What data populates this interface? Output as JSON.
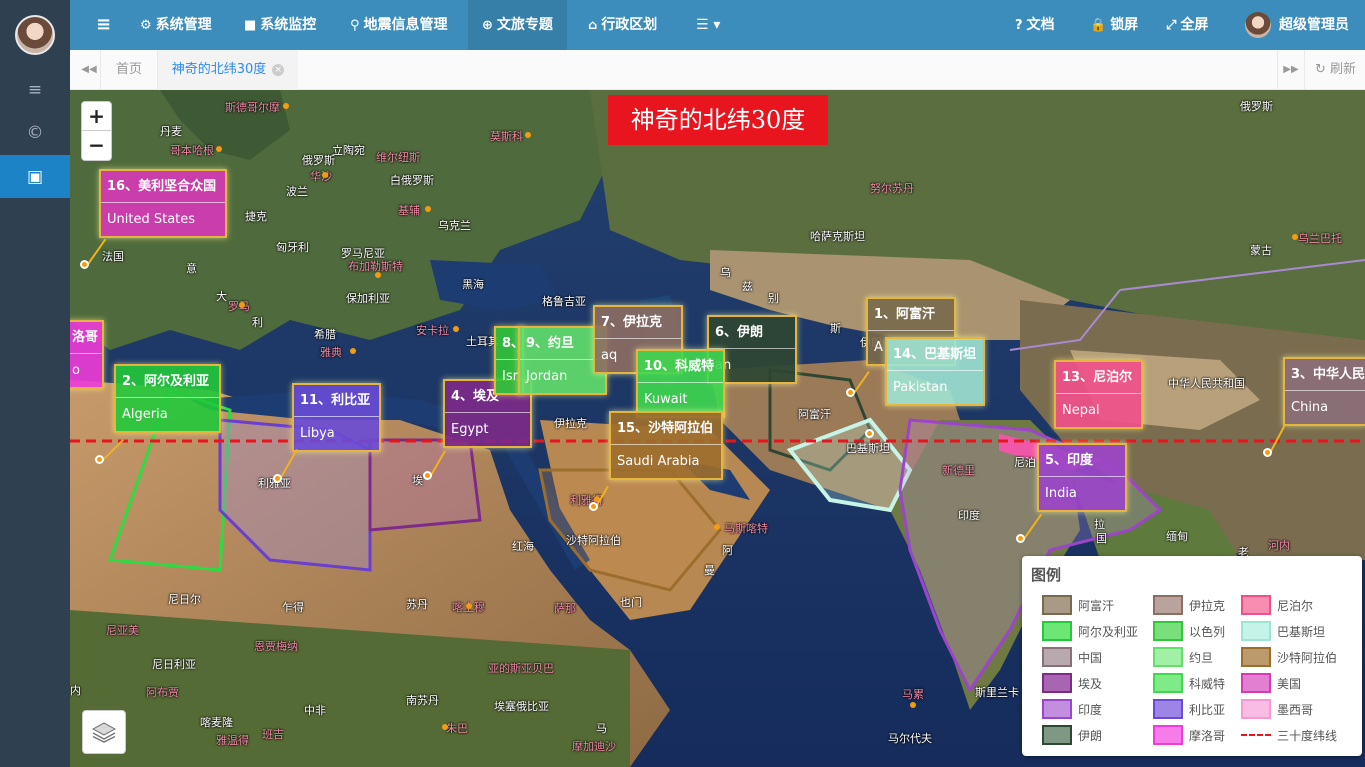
{
  "sidebar": {
    "items": [
      {
        "icon": "menu-icon",
        "glyph": "≡"
      },
      {
        "icon": "copyright-icon",
        "glyph": "©"
      },
      {
        "icon": "image-icon",
        "glyph": "▣"
      }
    ]
  },
  "topnav": {
    "menu_glyph": "≡",
    "items": [
      {
        "label": "系统管理",
        "icon": "gear-icon",
        "glyph": "⚙"
      },
      {
        "label": "系统监控",
        "icon": "video-camera-icon",
        "glyph": "■"
      },
      {
        "label": "地震信息管理",
        "icon": "map-marker-icon",
        "glyph": "⚲"
      },
      {
        "label": "文旅专题",
        "icon": "globe-icon",
        "glyph": "⊕"
      },
      {
        "label": "行政区划",
        "icon": "bank-icon",
        "glyph": "⌂"
      }
    ],
    "more_glyph": "☰ ▾",
    "right": {
      "docs": "文档",
      "docs_glyph": "?",
      "lock": "锁屏",
      "lock_glyph": "🔒",
      "fullscreen": "全屏",
      "fullscreen_glyph": "⤢",
      "user": "超级管理员"
    }
  },
  "tabs": {
    "prev_glyph": "◀◀",
    "next_glyph": "▶▶",
    "home": "首页",
    "current": "神奇的北纬30度",
    "close_glyph": "×",
    "refresh": "刷新",
    "refresh_glyph": "↻"
  },
  "map": {
    "title": "神奇的北纬30度",
    "zoom_in": "+",
    "zoom_out": "−",
    "countries": [
      {
        "cn": "16、美利坚合众国",
        "en": "United States",
        "color": "#d63ab6"
      },
      {
        "cn": "洛哥",
        "en": "o",
        "color": "#f03cd8"
      },
      {
        "cn": "2、阿尔及利亚",
        "en": "Algeria",
        "color": "#22c93a"
      },
      {
        "cn": "11、利比亚",
        "en": "Libya",
        "color": "#6a4bd6"
      },
      {
        "cn": "4、埃及",
        "en": "Egypt",
        "color": "#7d2a88"
      },
      {
        "cn": "8、",
        "en": "Isr",
        "color": "#32c63a"
      },
      {
        "cn": "9、约旦",
        "en": "Jordan",
        "color": "#62e06a"
      },
      {
        "cn": "7、伊拉克",
        "en": "aq",
        "color": "#8d6e63"
      },
      {
        "cn": "6、伊朗",
        "en": "an",
        "color": "#2e4733"
      },
      {
        "cn": "10、科威特",
        "en": "Kuwait",
        "color": "#3fd84f"
      },
      {
        "cn": "15、沙特阿拉伯",
        "en": "Saudi Arabia",
        "color": "#9c6e2c"
      },
      {
        "cn": "1、阿富汗",
        "en": "A",
        "color": "#7a6a4d"
      },
      {
        "cn": "14、巴基斯坦",
        "en": "Pakistan",
        "color": "#9ee4d2"
      },
      {
        "cn": "13、尼泊尔",
        "en": "Nepal",
        "color": "#f0508a"
      },
      {
        "cn": "5、印度",
        "en": "India",
        "color": "#9b45c8"
      },
      {
        "cn": "3、中华人民",
        "en": "China",
        "color": "#8a6f78"
      }
    ],
    "labels": [
      {
        "t": "斯德哥尔摩",
        "c": "p"
      },
      {
        "t": "丹麦",
        "c": "w"
      },
      {
        "t": "哥本哈根",
        "c": "p"
      },
      {
        "t": "立陶宛",
        "c": "w"
      },
      {
        "t": "维尔纽斯",
        "c": "p"
      },
      {
        "t": "俄罗斯",
        "c": "w"
      },
      {
        "t": "明斯克",
        "c": "p"
      },
      {
        "t": "华沙",
        "c": "p"
      },
      {
        "t": "白俄罗斯",
        "c": "w"
      },
      {
        "t": "波兰",
        "c": "w"
      },
      {
        "t": "基辅",
        "c": "p"
      },
      {
        "t": "捷克",
        "c": "w"
      },
      {
        "t": "乌克兰",
        "c": "w"
      },
      {
        "t": "匈牙利",
        "c": "w"
      },
      {
        "t": "罗马尼亚",
        "c": "w"
      },
      {
        "t": "布加勒斯特",
        "c": "p"
      },
      {
        "t": "法国",
        "c": "w"
      },
      {
        "t": "意",
        "c": "w"
      },
      {
        "t": "黑海",
        "c": "w"
      },
      {
        "t": "大",
        "c": "w"
      },
      {
        "t": "罗马",
        "c": "p"
      },
      {
        "t": "保加利亚",
        "c": "w"
      },
      {
        "t": "格鲁吉亚",
        "c": "w"
      },
      {
        "t": "安卡拉",
        "c": "p"
      },
      {
        "t": "土耳其",
        "c": "w"
      },
      {
        "t": "利",
        "c": "w"
      },
      {
        "t": "希腊",
        "c": "w"
      },
      {
        "t": "雅典",
        "c": "p"
      },
      {
        "t": "莫斯科",
        "c": "p"
      },
      {
        "t": "乌",
        "c": "w"
      },
      {
        "t": "兹",
        "c": "w"
      },
      {
        "t": "别",
        "c": "w"
      },
      {
        "t": "斯",
        "c": "w"
      },
      {
        "t": "哈萨克斯坦",
        "c": "w"
      },
      {
        "t": "努尔苏丹",
        "c": "p"
      },
      {
        "t": "俄罗斯",
        "c": "w"
      },
      {
        "t": "蒙古",
        "c": "w"
      },
      {
        "t": "乌兰巴托",
        "c": "p"
      },
      {
        "t": "中华人民共和国",
        "c": "w"
      },
      {
        "t": "伊拉克",
        "c": "w"
      },
      {
        "t": "阿富汗",
        "c": "w"
      },
      {
        "t": "巴基斯坦",
        "c": "w"
      },
      {
        "t": "新德里",
        "c": "p"
      },
      {
        "t": "尼泊",
        "c": "w"
      },
      {
        "t": "印度",
        "c": "w"
      },
      {
        "t": "缅甸",
        "c": "w"
      },
      {
        "t": "拉",
        "c": "w"
      },
      {
        "t": "国",
        "c": "w"
      },
      {
        "t": "老",
        "c": "w"
      },
      {
        "t": "河内",
        "c": "p"
      },
      {
        "t": "利雅得",
        "c": "p"
      },
      {
        "t": "马斯喀特",
        "c": "p"
      },
      {
        "t": "沙特阿拉伯",
        "c": "w"
      },
      {
        "t": "阿",
        "c": "w"
      },
      {
        "t": "曼",
        "c": "w"
      },
      {
        "t": "红海",
        "c": "w"
      },
      {
        "t": "利比亚",
        "c": "w"
      },
      {
        "t": "埃",
        "c": "w"
      },
      {
        "t": "尼日尔",
        "c": "w"
      },
      {
        "t": "乍得",
        "c": "w"
      },
      {
        "t": "苏丹",
        "c": "w"
      },
      {
        "t": "喀土穆",
        "c": "p"
      },
      {
        "t": "也门",
        "c": "w"
      },
      {
        "t": "萨那",
        "c": "p"
      },
      {
        "t": "尼亚美",
        "c": "p"
      },
      {
        "t": "恩贾梅纳",
        "c": "p"
      },
      {
        "t": "尼日利亚",
        "c": "w"
      },
      {
        "t": "阿布贾",
        "c": "p"
      },
      {
        "t": "中非",
        "c": "w"
      },
      {
        "t": "南苏丹",
        "c": "w"
      },
      {
        "t": "亚的斯亚贝巴",
        "c": "p"
      },
      {
        "t": "埃塞俄比亚",
        "c": "w"
      },
      {
        "t": "喀麦隆",
        "c": "w"
      },
      {
        "t": "雅温得",
        "c": "p"
      },
      {
        "t": "班吉",
        "c": "p"
      },
      {
        "t": "朱巴",
        "c": "p"
      },
      {
        "t": "马",
        "c": "w"
      },
      {
        "t": "摩加迪沙",
        "c": "p"
      },
      {
        "t": "马累",
        "c": "p"
      },
      {
        "t": "斯里兰卡",
        "c": "w"
      },
      {
        "t": "马尔代夫",
        "c": "w"
      },
      {
        "t": "内",
        "c": "w"
      },
      {
        "t": "伊斯兰堡",
        "c": "p"
      },
      {
        "t": "阿尔及尔",
        "c": "p"
      },
      {
        "t": "利雅亚",
        "c": "w"
      },
      {
        "t": "埃",
        "c": "w"
      },
      {
        "t": "伊朗",
        "c": "w"
      }
    ]
  },
  "legend": {
    "title": "图例",
    "items": [
      {
        "name": "阿富汗",
        "fill": "#a89a84",
        "border": "#7a6a4d"
      },
      {
        "name": "伊拉克",
        "fill": "#bba39d",
        "border": "#8d6e63"
      },
      {
        "name": "尼泊尔",
        "fill": "#f78db0",
        "border": "#f0508a"
      },
      {
        "name": "阿尔及利亚",
        "fill": "#6ee676",
        "border": "#22c93a"
      },
      {
        "name": "以色列",
        "fill": "#79df7c",
        "border": "#32c63a"
      },
      {
        "name": "巴基斯坦",
        "fill": "#c4f4e8",
        "border": "#9ee4d2"
      },
      {
        "name": "中国",
        "fill": "#b8a9ae",
        "border": "#8a6f78"
      },
      {
        "name": "约旦",
        "fill": "#a2efa6",
        "border": "#62e06a"
      },
      {
        "name": "沙特阿拉伯",
        "fill": "#bb9a6b",
        "border": "#9c6e2c"
      },
      {
        "name": "埃及",
        "fill": "#a865b2",
        "border": "#7d2a88"
      },
      {
        "name": "科威特",
        "fill": "#7fea88",
        "border": "#3fd84f"
      },
      {
        "name": "美国",
        "fill": "#e37fd0",
        "border": "#d63ab6"
      },
      {
        "name": "印度",
        "fill": "#c48ee0",
        "border": "#9b45c8"
      },
      {
        "name": "利比亚",
        "fill": "#9c85e6",
        "border": "#6a4bd6"
      },
      {
        "name": "墨西哥",
        "fill": "#f9bce4",
        "border": "#f59ad2"
      },
      {
        "name": "伊朗",
        "fill": "#7f9883",
        "border": "#2e4733"
      },
      {
        "name": "摩洛哥",
        "fill": "#f57ce9",
        "border": "#f03cd8"
      },
      {
        "name": "三十度纬线",
        "dash": "#e8141e"
      }
    ]
  }
}
